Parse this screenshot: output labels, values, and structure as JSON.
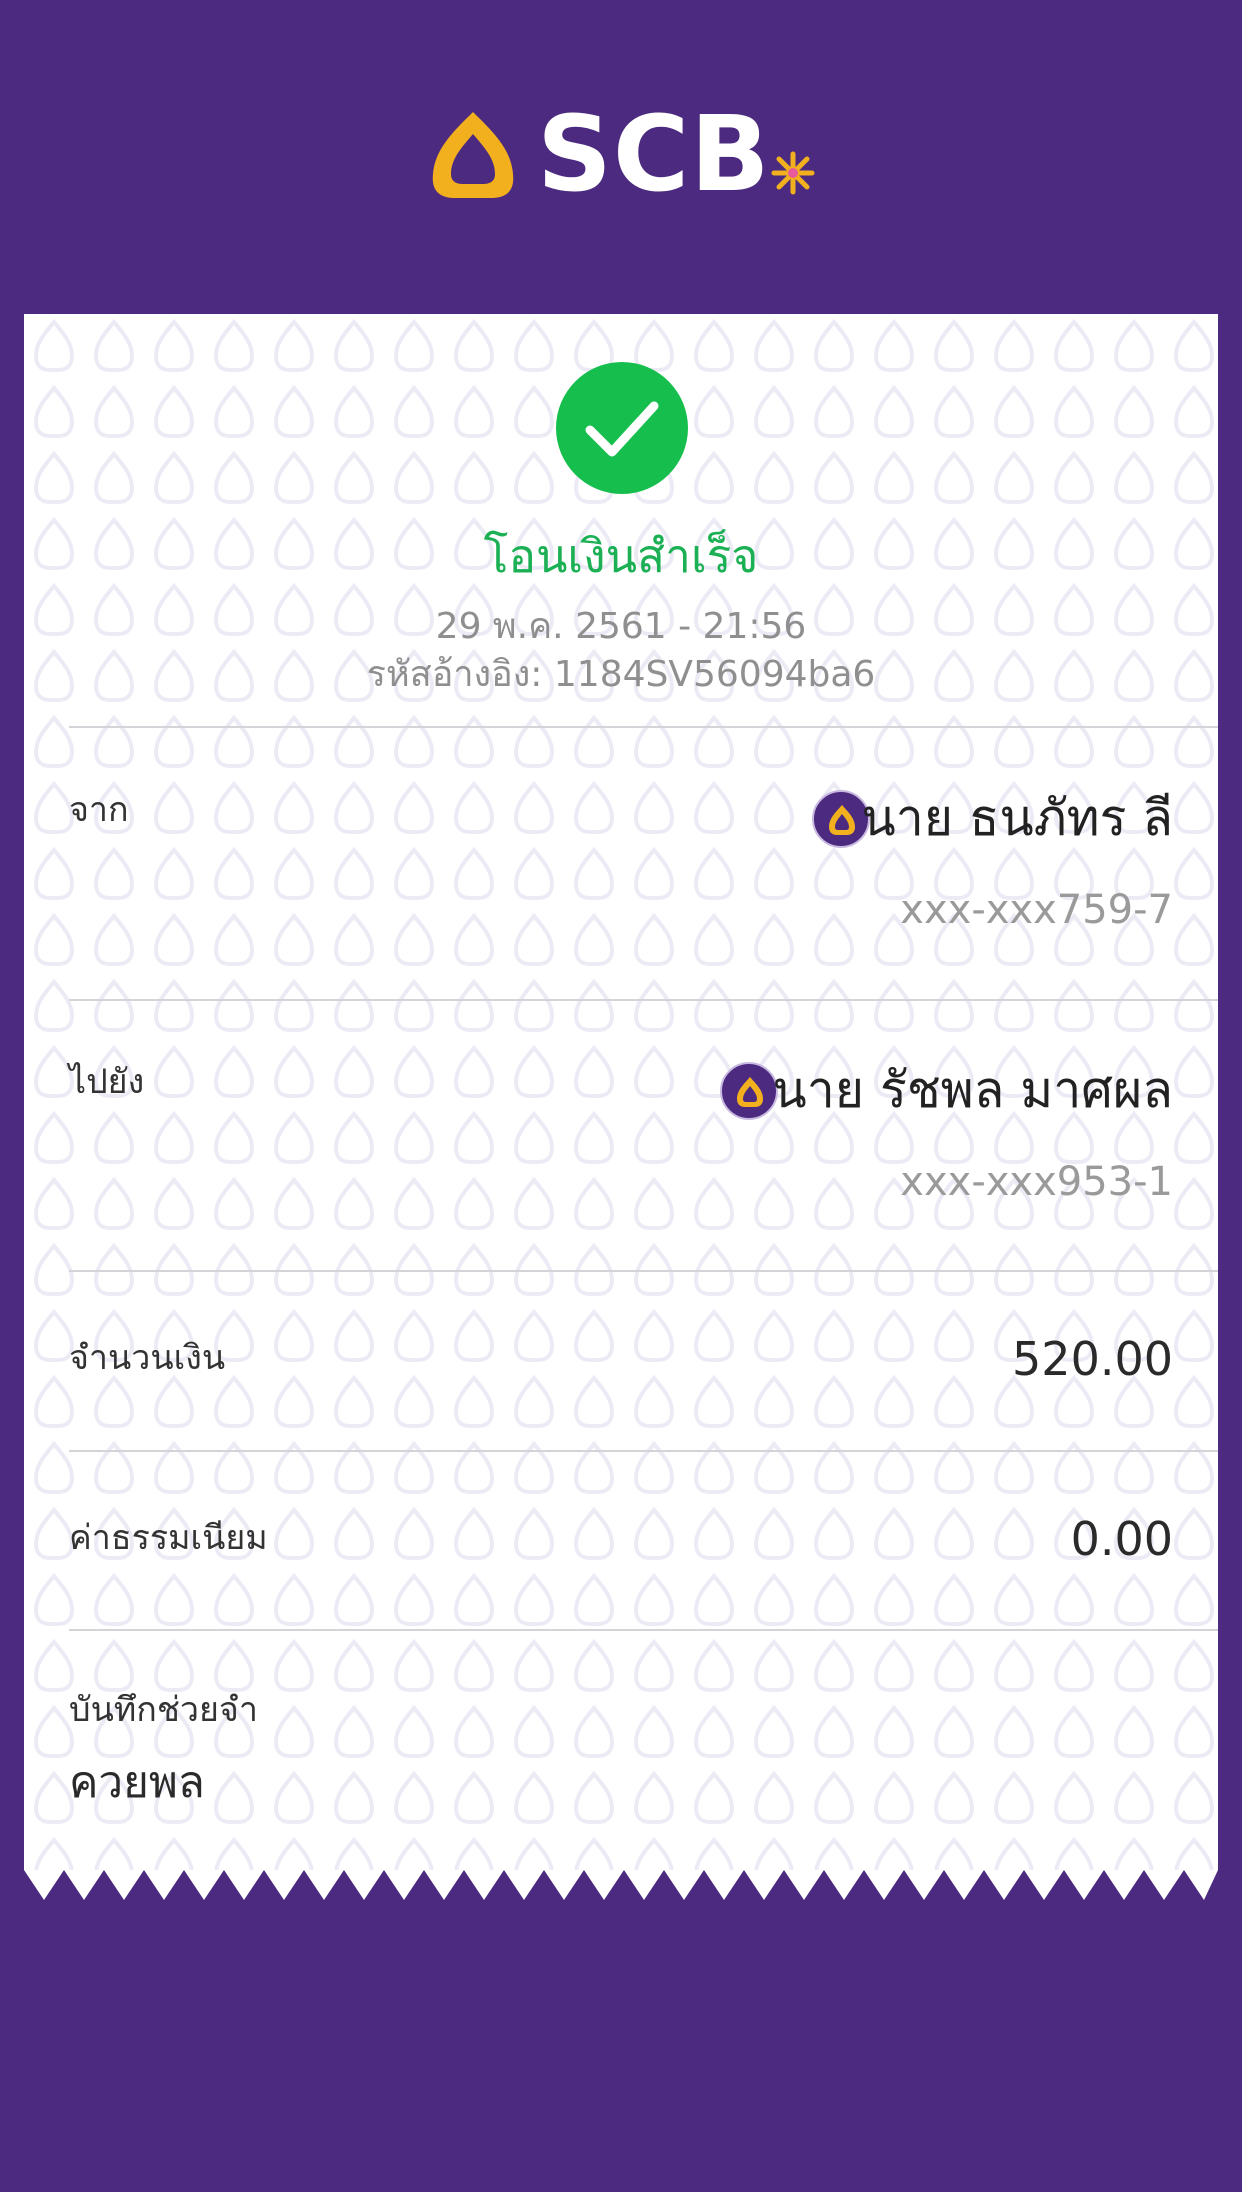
{
  "brand": {
    "name": "SCB",
    "color_purple": "#4b2a7f",
    "color_gold": "#f2b01e"
  },
  "status": {
    "icon": "check-icon",
    "title": "โอนเงินสำเร็จ",
    "datetime": "29 พ.ค. 2561 - 21:56",
    "reference": "รหัสอ้างอิง: 1184SV56094ba6",
    "color": "#16bf4d"
  },
  "from": {
    "label": "จาก",
    "name": "นาย ธนภัทร ลี",
    "account": "xxx-xxx759-7"
  },
  "to": {
    "label": "ไปยัง",
    "name": "นาย รัชพล มาศผล",
    "account": "xxx-xxx953-1"
  },
  "amount": {
    "label": "จำนวนเงิน",
    "value": "520.00"
  },
  "fee": {
    "label": "ค่าธรรมเนียม",
    "value": "0.00"
  },
  "memo": {
    "label": "บันทึกช่วยจำ",
    "value": "ควยพล"
  }
}
